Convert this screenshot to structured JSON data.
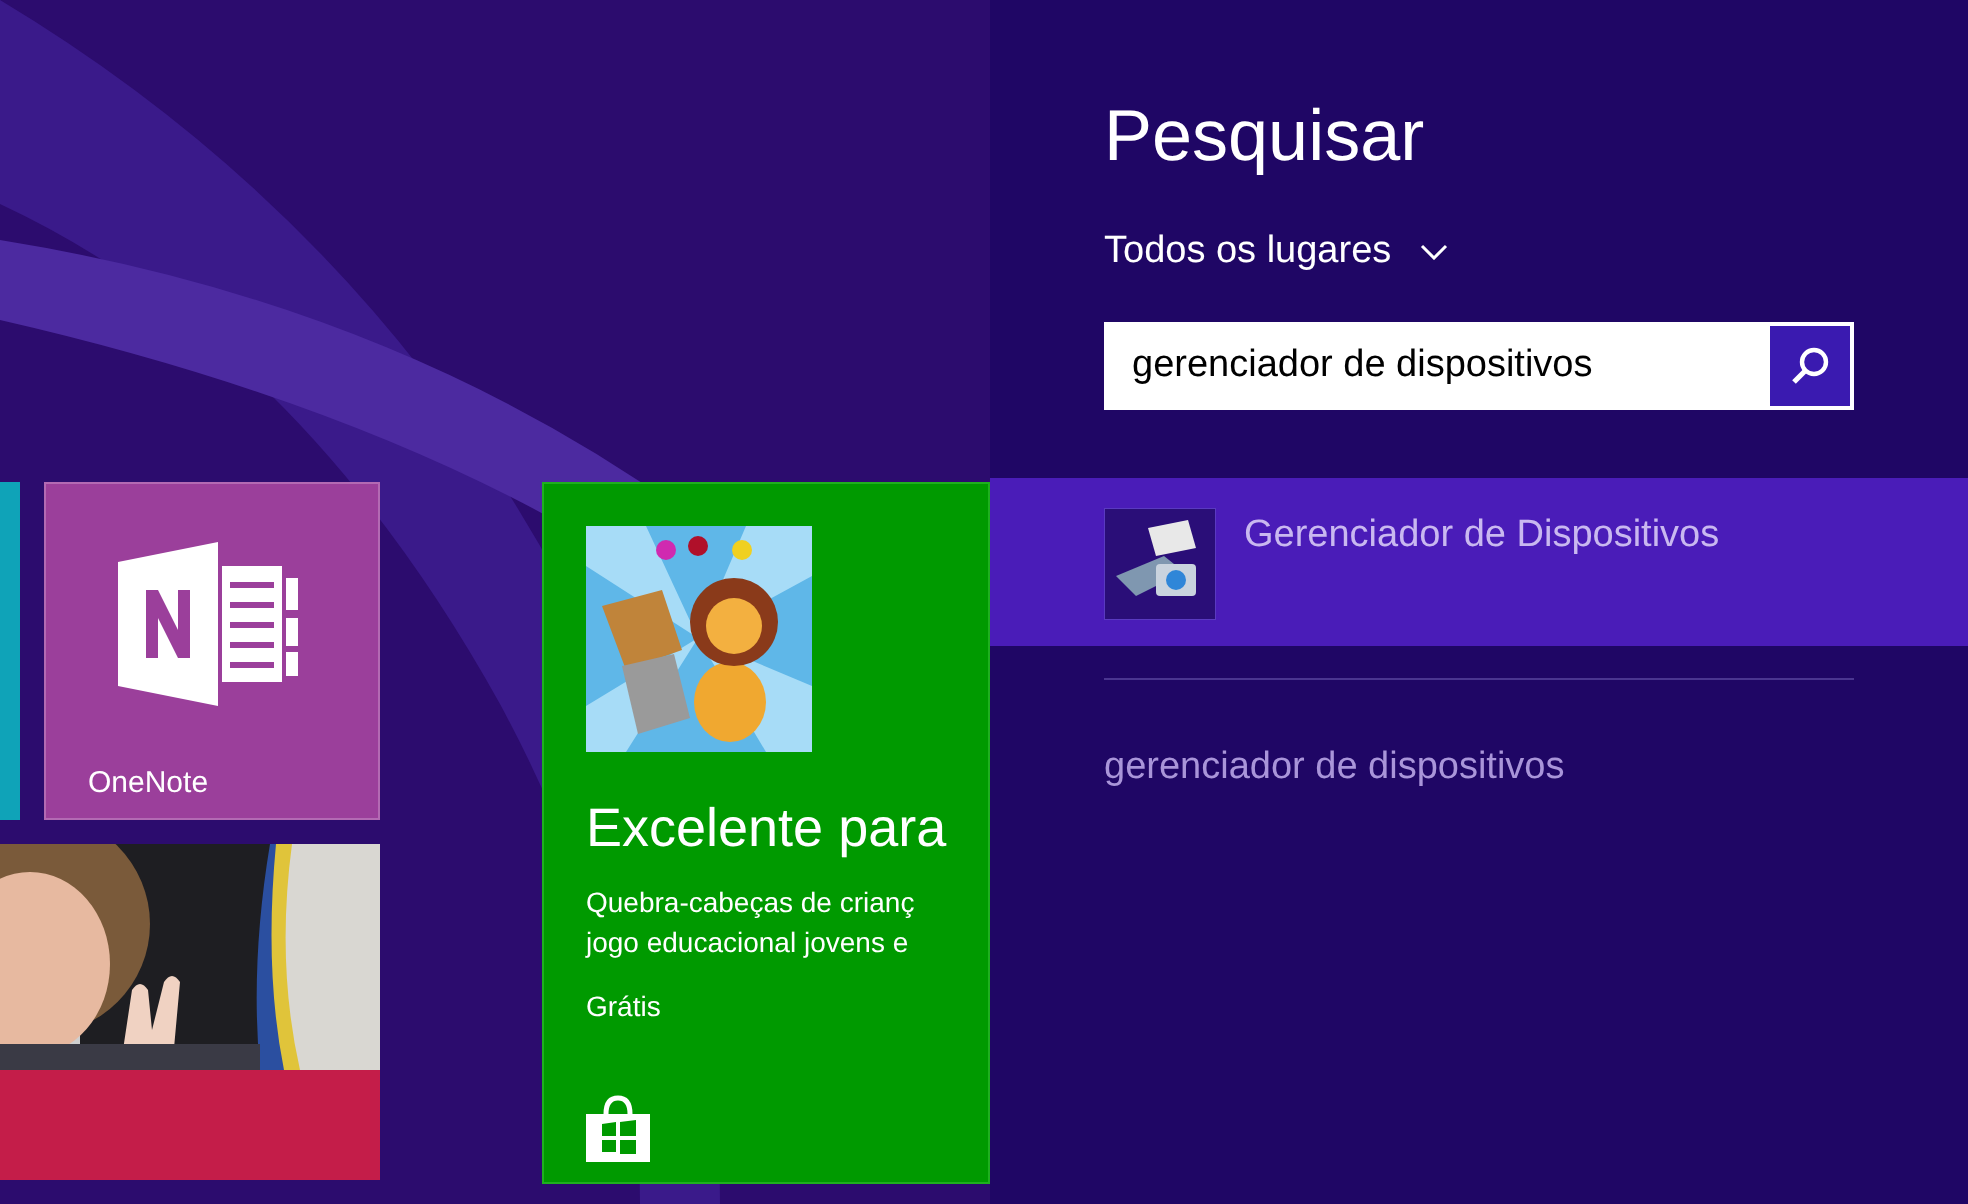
{
  "start_screen": {
    "tiles": [
      {
        "kind": "strip",
        "color": "#0fa3b8"
      },
      {
        "kind": "app",
        "label": "OneNote",
        "color": "#9b3f9b"
      },
      {
        "kind": "picture"
      },
      {
        "kind": "plain",
        "color": "#c41d49"
      }
    ],
    "store_tile": {
      "title": "Excelente para",
      "description": "Quebra-cabeças de crianç\njogo educacional jovens e",
      "price": "Grátis"
    }
  },
  "search_panel": {
    "title": "Pesquisar",
    "scope": "Todos os lugares",
    "search_field": {
      "value": "gerenciador de dispositivos"
    },
    "results": [
      {
        "label": "Gerenciador de Dispositivos",
        "selected": true
      }
    ],
    "suggestions": [
      "gerenciador de dispositivos"
    ]
  }
}
